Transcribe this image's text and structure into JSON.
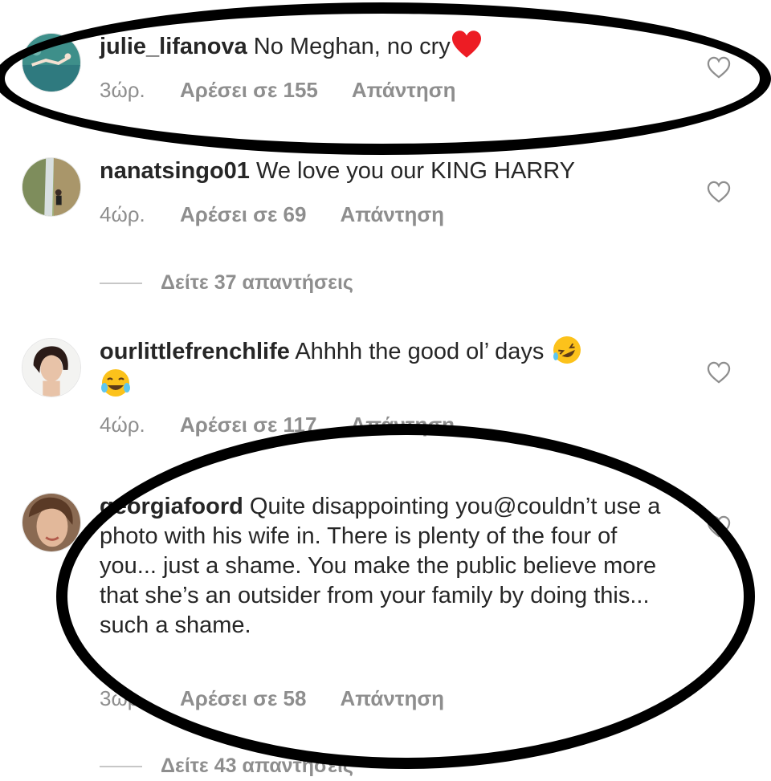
{
  "comments": [
    {
      "username": "julie_lifanova",
      "text": "No Meghan, no cry",
      "emoji": "red-heart",
      "time": "3ώρ.",
      "likes": "Αρέσει σε 155",
      "reply": "Απάντηση"
    },
    {
      "username": "nanatsingo01",
      "text": "We love you our KING HARRY",
      "time": "4ώρ.",
      "likes": "Αρέσει σε 69",
      "reply": "Απάντηση",
      "view_replies": "Δείτε 37 απαντήσεις"
    },
    {
      "username": "ourlittlefrenchlife",
      "text": "Ahhhh the good ol’ days",
      "emojis": [
        "rolling-laughing-emoji",
        "tears-of-joy-emoji"
      ],
      "time": "4ώρ.",
      "likes": "Αρέσει σε 117",
      "reply": "Απάντηση"
    },
    {
      "username": "georgiafoord",
      "text": "Quite disappointing you@couldn’t use a photo with his wife in. There is plenty of the four of you... just a shame. You make the public believe more that she’s an outsider from your family by doing this... such a shame.",
      "time": "3ώρ.",
      "likes": "Αρέσει σε 58",
      "reply": "Απάντηση",
      "view_replies": "Δείτε 43 απαντήσεις"
    }
  ],
  "colors": {
    "text": "#262626",
    "secondary": "#8e8e8e",
    "annotation": "#000000",
    "heart": "#ed1c24"
  }
}
